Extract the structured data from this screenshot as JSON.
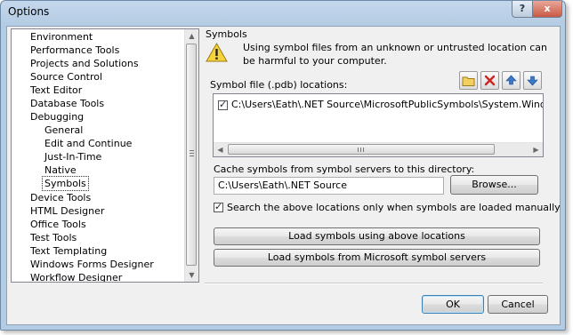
{
  "window": {
    "title": "Options",
    "help_label": "?",
    "close_label": "x"
  },
  "tree": {
    "items": [
      {
        "label": "Environment"
      },
      {
        "label": "Performance Tools"
      },
      {
        "label": "Projects and Solutions"
      },
      {
        "label": "Source Control"
      },
      {
        "label": "Text Editor"
      },
      {
        "label": "Database Tools"
      },
      {
        "label": "Debugging"
      },
      {
        "label": "General"
      },
      {
        "label": "Edit and Continue"
      },
      {
        "label": "Just-In-Time"
      },
      {
        "label": "Native"
      },
      {
        "label": "Symbols",
        "selected": true
      },
      {
        "label": "Device Tools"
      },
      {
        "label": "HTML Designer"
      },
      {
        "label": "Office Tools"
      },
      {
        "label": "Test Tools"
      },
      {
        "label": "Text Templating"
      },
      {
        "label": "Windows Forms Designer"
      },
      {
        "label": "Workflow Designer"
      }
    ]
  },
  "symbols": {
    "section_title": "Symbols",
    "warning_text": "Using symbol files from an unknown or untrusted location can be harmful to your computer.",
    "locations_label": "Symbol file (.pdb) locations:",
    "locations": [
      {
        "path": "C:\\Users\\Eath\\.NET Source\\MicrosoftPublicSymbols\\System.Windows.Forms.",
        "checked": true
      }
    ],
    "toolbar": [
      "folder-icon",
      "delete-icon",
      "move-up-icon",
      "move-down-icon"
    ],
    "cache_label": "Cache symbols from symbol servers to this directory:",
    "cache_value": "C:\\Users\\Eath\\.NET Source",
    "browse_label": "Browse...",
    "manual_load_label": "Search the above locations only when symbols are loaded manually",
    "manual_load_checked": true,
    "load_above_label": "Load symbols using above locations",
    "load_ms_label": "Load symbols from Microsoft symbol servers"
  },
  "footer": {
    "ok_label": "OK",
    "cancel_label": "Cancel"
  }
}
